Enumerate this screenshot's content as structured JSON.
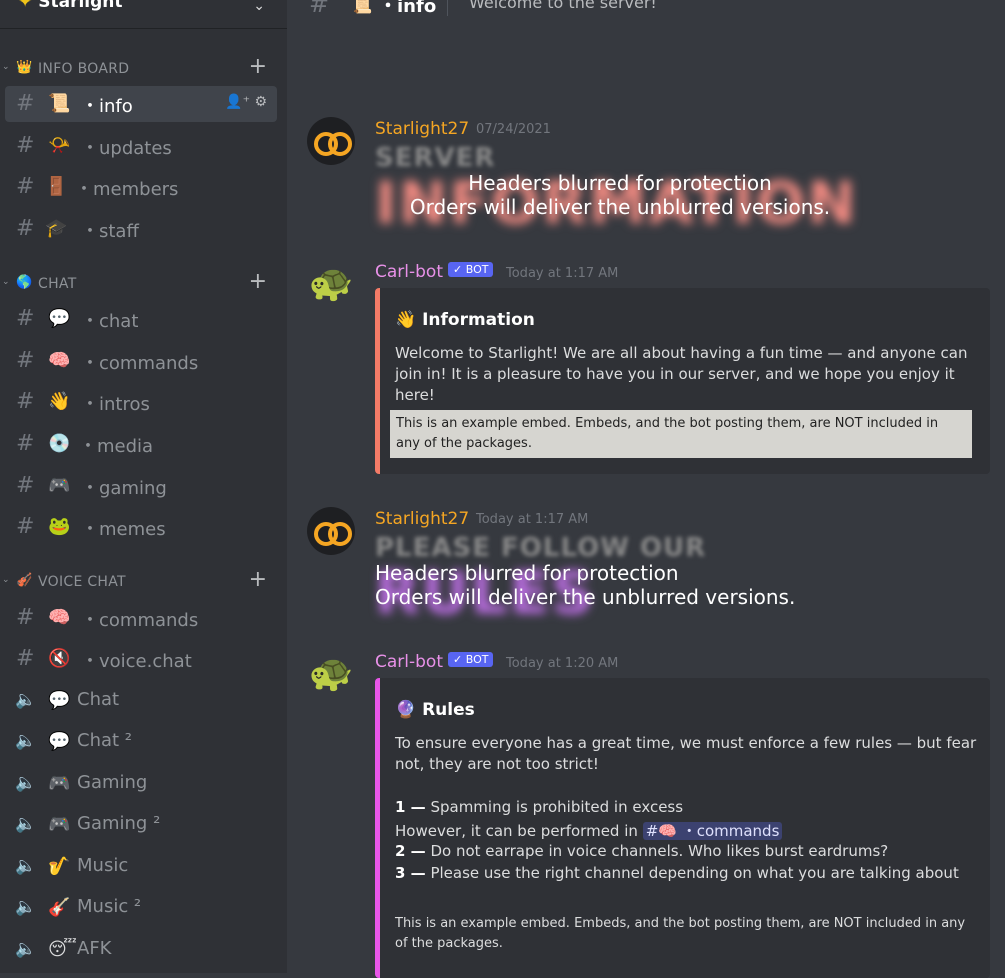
{
  "server": {
    "name": "Starlight",
    "icon": "sparkle-icon"
  },
  "topbar": {
    "channel": "・info",
    "emoji": "📜",
    "topic": "Welcome to the server!"
  },
  "categories": [
    {
      "label": "INFO BOARD",
      "icon": "👑"
    },
    {
      "label": "CHAT",
      "icon": "🌎"
    },
    {
      "label": "VOICE CHAT",
      "icon": "🎻"
    }
  ],
  "channels": [
    {
      "emoji": "📜",
      "label": "・info"
    },
    {
      "emoji": "📯",
      "label": "・updates"
    },
    {
      "emoji": "🚪",
      "label": "・members"
    },
    {
      "emoji": "🎓",
      "label": "・staff"
    },
    {
      "emoji": "💬",
      "label": "・chat"
    },
    {
      "emoji": "🧠",
      "label": "・commands"
    },
    {
      "emoji": "👋",
      "label": "・intros"
    },
    {
      "emoji": "💿",
      "label": "・media"
    },
    {
      "emoji": "🎮",
      "label": "・gaming"
    },
    {
      "emoji": "🐸",
      "label": "・memes"
    },
    {
      "emoji": "🧠",
      "label": "・commands"
    },
    {
      "emoji": "🔇",
      "label": "・voice.chat"
    },
    {
      "emoji": "💬",
      "label": "Chat"
    },
    {
      "emoji": "💬",
      "label": "Chat ²"
    },
    {
      "emoji": "🎮",
      "label": "Gaming"
    },
    {
      "emoji": "🎮",
      "label": "Gaming ²"
    },
    {
      "emoji": "🎷",
      "label": "Music"
    },
    {
      "emoji": "🎸",
      "label": "Music ²"
    },
    {
      "emoji": "😴",
      "label": "AFK"
    }
  ],
  "messages": [
    {
      "author": "Starlight27",
      "time": "07/24/2021",
      "banner_small": "SERVER",
      "banner_big": "INFORMATION",
      "note1": "Headers blurred for protection",
      "note2": "Orders will deliver the unblurred versions."
    },
    {
      "author": "Carl-bot",
      "bot": "✓ BOT",
      "time": "Today at 1:17 AM",
      "embed_title": "👋 Information",
      "embed_text": "Welcome to Starlight! We are all about having a fun time — and anyone can join in! It is a pleasure to have you in our server, and we hope you enjoy it here!",
      "footer": "This is an example embed. Embeds, and the bot posting them, are NOT included in any of the packages."
    },
    {
      "author": "Starlight27",
      "time": "Today at 1:17 AM",
      "banner_small": "PLEASE FOLLOW OUR",
      "banner_big": "RULES",
      "note1": "Headers blurred for protection",
      "note2": "Orders will deliver the unblurred versions."
    },
    {
      "author": "Carl-bot",
      "bot": "✓ BOT",
      "time": "Today at 1:20 AM",
      "embed_title": "🔮 Rules",
      "embed_text": "To ensure everyone has a great time, we must enforce a few rules — but fear not, they are not too strict!",
      "rule1_num": "1 —",
      "rule1": "Spamming is prohibited in excess",
      "rule1b": "However, it can be performed in",
      "mention": "#🧠 ・commands",
      "rule2_num": "2 —",
      "rule2": "Do not earrape in voice channels. Who likes burst eardrums?",
      "rule3_num": "3 —",
      "rule3": "Please use the right channel depending on what you are talking about",
      "footer": "This is an example embed. Embeds, and the bot posting them, are NOT included in any of the packages."
    }
  ]
}
